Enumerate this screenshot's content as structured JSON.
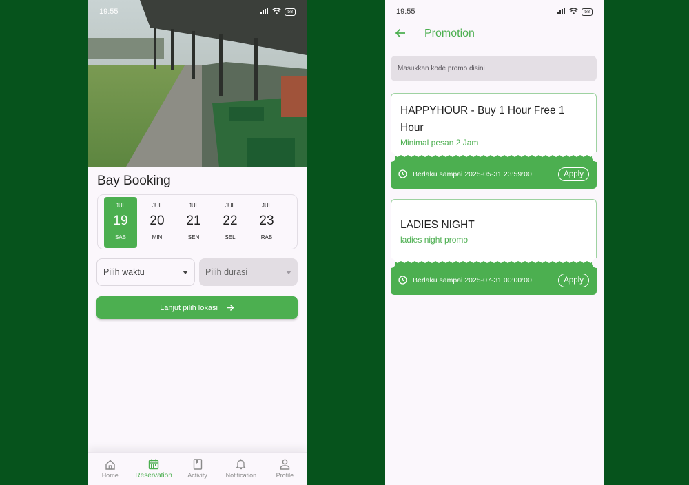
{
  "left": {
    "status": {
      "time": "19:55",
      "battery": "58"
    },
    "title": "Bay Booking",
    "dates": [
      {
        "month": "JUL",
        "day": "19",
        "weekday": "SAB",
        "selected": true
      },
      {
        "month": "JUL",
        "day": "20",
        "weekday": "MIN",
        "selected": false
      },
      {
        "month": "JUL",
        "day": "21",
        "weekday": "SEN",
        "selected": false
      },
      {
        "month": "JUL",
        "day": "22",
        "weekday": "SEL",
        "selected": false
      },
      {
        "month": "JUL",
        "day": "23",
        "weekday": "RAB",
        "selected": false
      }
    ],
    "time_dropdown": {
      "label": "Pilih waktu",
      "icon": "chevron-down-icon"
    },
    "duration_dropdown": {
      "label": "Pilih durasi",
      "icon": "chevron-down-icon",
      "disabled": true
    },
    "cta": {
      "label": "Lanjut pilih lokasi",
      "icon": "arrow-right-icon"
    },
    "nav": [
      {
        "label": "Home",
        "icon": "home-icon",
        "active": false
      },
      {
        "label": "Reservation",
        "icon": "calendar-icon",
        "active": true
      },
      {
        "label": "Activity",
        "icon": "book-icon",
        "active": false
      },
      {
        "label": "Notification",
        "icon": "bell-icon",
        "active": false
      },
      {
        "label": "Profile",
        "icon": "person-icon",
        "active": false
      }
    ]
  },
  "right": {
    "status": {
      "time": "19:55",
      "battery": "58"
    },
    "title": "Promotion",
    "promo_input": {
      "placeholder": "Masukkan kode promo disini",
      "value": ""
    },
    "promos": [
      {
        "title": "HAPPYHOUR - Buy 1 Hour Free 1 Hour",
        "subtitle": "Minimal pesan 2 Jam",
        "validity": "Berlaku sampai 2025-05-31 23:59:00",
        "apply_label": "Apply"
      },
      {
        "title": "LADIES NIGHT",
        "subtitle": "ladies night promo",
        "validity": "Berlaku sampai 2025-07-31 00:00:00",
        "apply_label": "Apply"
      }
    ]
  },
  "colors": {
    "background": "#06531c",
    "primary": "#4caf50",
    "surface": "#fbf7fc"
  }
}
